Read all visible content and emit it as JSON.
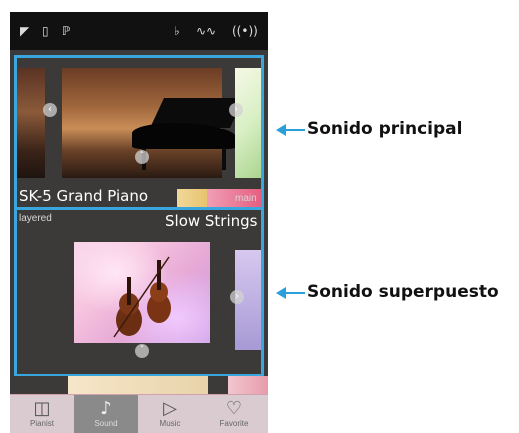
{
  "statusbar": {
    "icons": [
      "headphones-icon",
      "usb-drive-icon",
      "bluetooth-icon",
      "metronome-icon",
      "waveform-icon",
      "wireless-icon"
    ]
  },
  "sounds": {
    "main": {
      "name": "SK-5 Grand Piano",
      "tag": "main"
    },
    "layered": {
      "name": "Slow Strings",
      "tag": "layered"
    }
  },
  "tabs": [
    {
      "label": "Pianist",
      "icon": "piano-icon",
      "active": false
    },
    {
      "label": "Sound",
      "icon": "music-note-icon",
      "active": true
    },
    {
      "label": "Music",
      "icon": "play-icon",
      "active": false
    },
    {
      "label": "Favorite",
      "icon": "heart-icon",
      "active": false
    }
  ],
  "callouts": {
    "main": "Sonido principal",
    "layered": "Sonido superpuesto"
  },
  "colors": {
    "highlight": "#3aa6dd",
    "arrow": "#2a9fd9",
    "tabbar": "#d9cbcf",
    "active_tab": "#8a8a8a"
  }
}
